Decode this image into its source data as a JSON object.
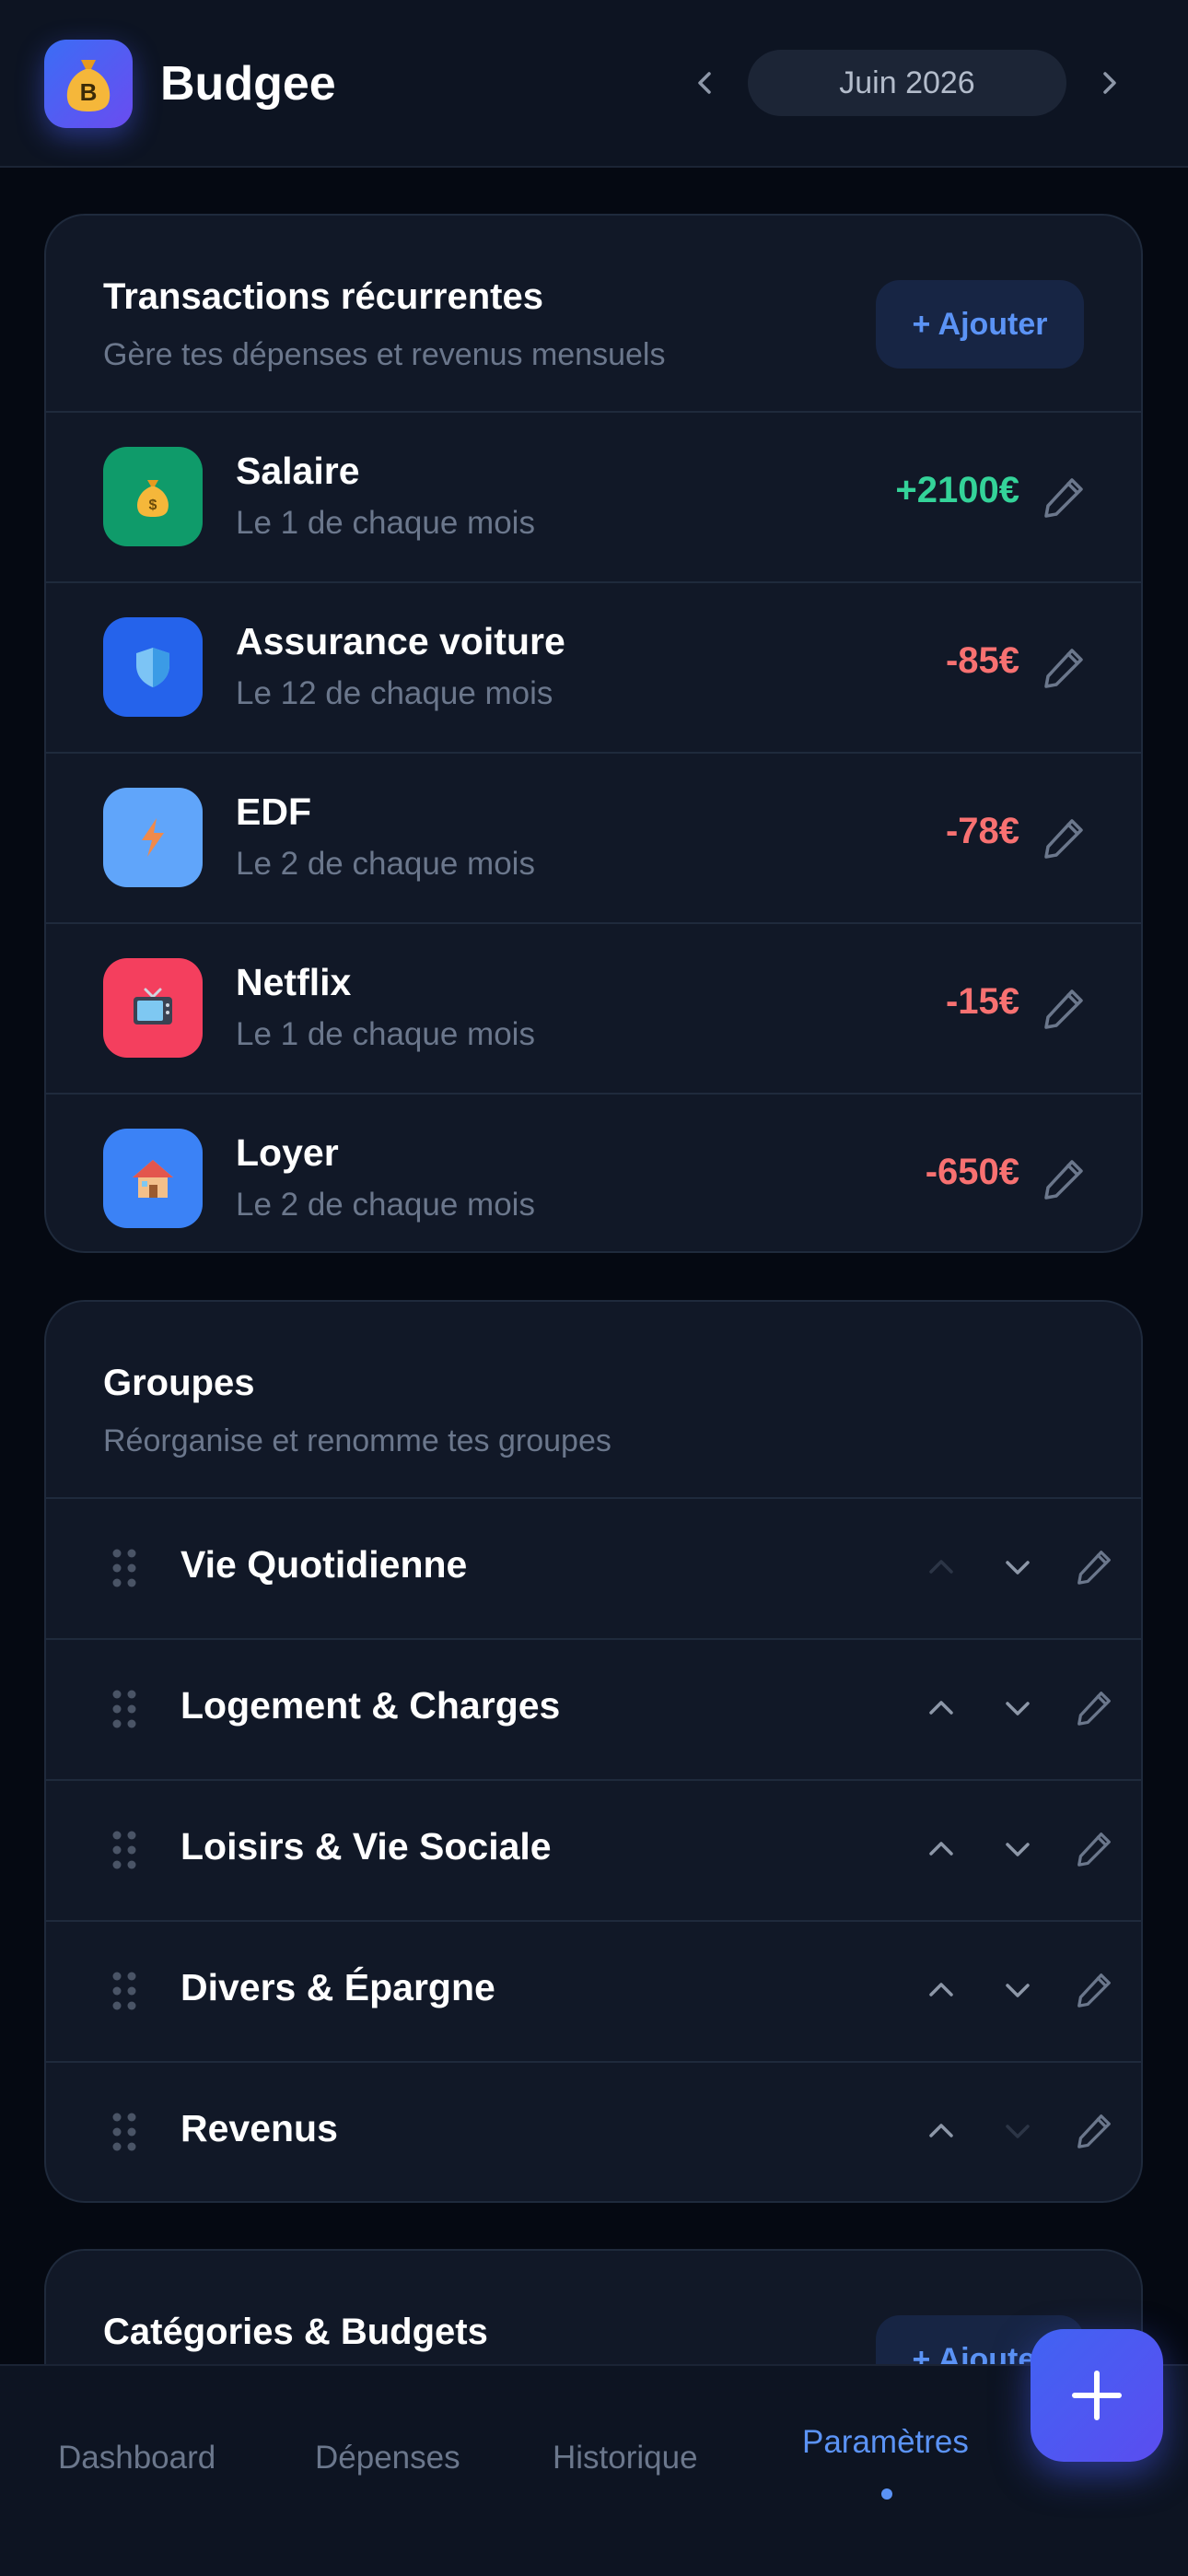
{
  "header": {
    "app_title": "Budgee",
    "logo_letter": "B",
    "month": "Juin 2026",
    "prev_icon": "chevron-left-icon",
    "next_icon": "chevron-right-icon"
  },
  "recurring": {
    "title": "Transactions récurrentes",
    "subtitle": "Gère tes dépenses et revenus mensuels",
    "add_label": "+ Ajouter",
    "items": [
      {
        "name": "Salaire",
        "schedule": "Le 1 de chaque mois",
        "amount": "+2100€",
        "icon": "money-bag-icon",
        "icon_bg": "#0f9b6a",
        "amount_color": "#34d399"
      },
      {
        "name": "Assurance voiture",
        "schedule": "Le 12 de chaque mois",
        "amount": "-85€",
        "icon": "shield-icon",
        "icon_bg": "#2563eb",
        "amount_color": "#f87171"
      },
      {
        "name": "EDF",
        "schedule": "Le 2 de chaque mois",
        "amount": "-78€",
        "icon": "lightning-icon",
        "icon_bg": "#60a5fa",
        "amount_color": "#f87171"
      },
      {
        "name": "Netflix",
        "schedule": "Le 1 de chaque mois",
        "amount": "-15€",
        "icon": "tv-icon",
        "icon_bg": "#f43f5e",
        "amount_color": "#f87171"
      },
      {
        "name": "Loyer",
        "schedule": "Le 2 de chaque mois",
        "amount": "-650€",
        "icon": "house-icon",
        "icon_bg": "#3b82f6",
        "amount_color": "#f87171"
      }
    ]
  },
  "groups": {
    "title": "Groupes",
    "subtitle": "Réorganise et renomme tes groupes",
    "items": [
      {
        "name": "Vie Quotidienne",
        "up_enabled": false,
        "down_enabled": true
      },
      {
        "name": "Logement & Charges",
        "up_enabled": true,
        "down_enabled": true
      },
      {
        "name": "Loisirs & Vie Sociale",
        "up_enabled": true,
        "down_enabled": true
      },
      {
        "name": "Divers & Épargne",
        "up_enabled": true,
        "down_enabled": true
      },
      {
        "name": "Revenus",
        "up_enabled": true,
        "down_enabled": false
      }
    ]
  },
  "categories": {
    "title": "Catégories & Budgets",
    "add_label": "+ Ajouter"
  },
  "nav": {
    "items": [
      {
        "label": "Dashboard",
        "active": false
      },
      {
        "label": "Dépenses",
        "active": false
      },
      {
        "label": "Historique",
        "active": false
      },
      {
        "label": "Paramètres",
        "active": true
      }
    ]
  },
  "fab": {
    "icon": "plus-icon"
  },
  "colors": {
    "accent": "#5b93f5",
    "income": "#34d399",
    "expense": "#f87171",
    "background": "#050912",
    "card": "#111827"
  }
}
